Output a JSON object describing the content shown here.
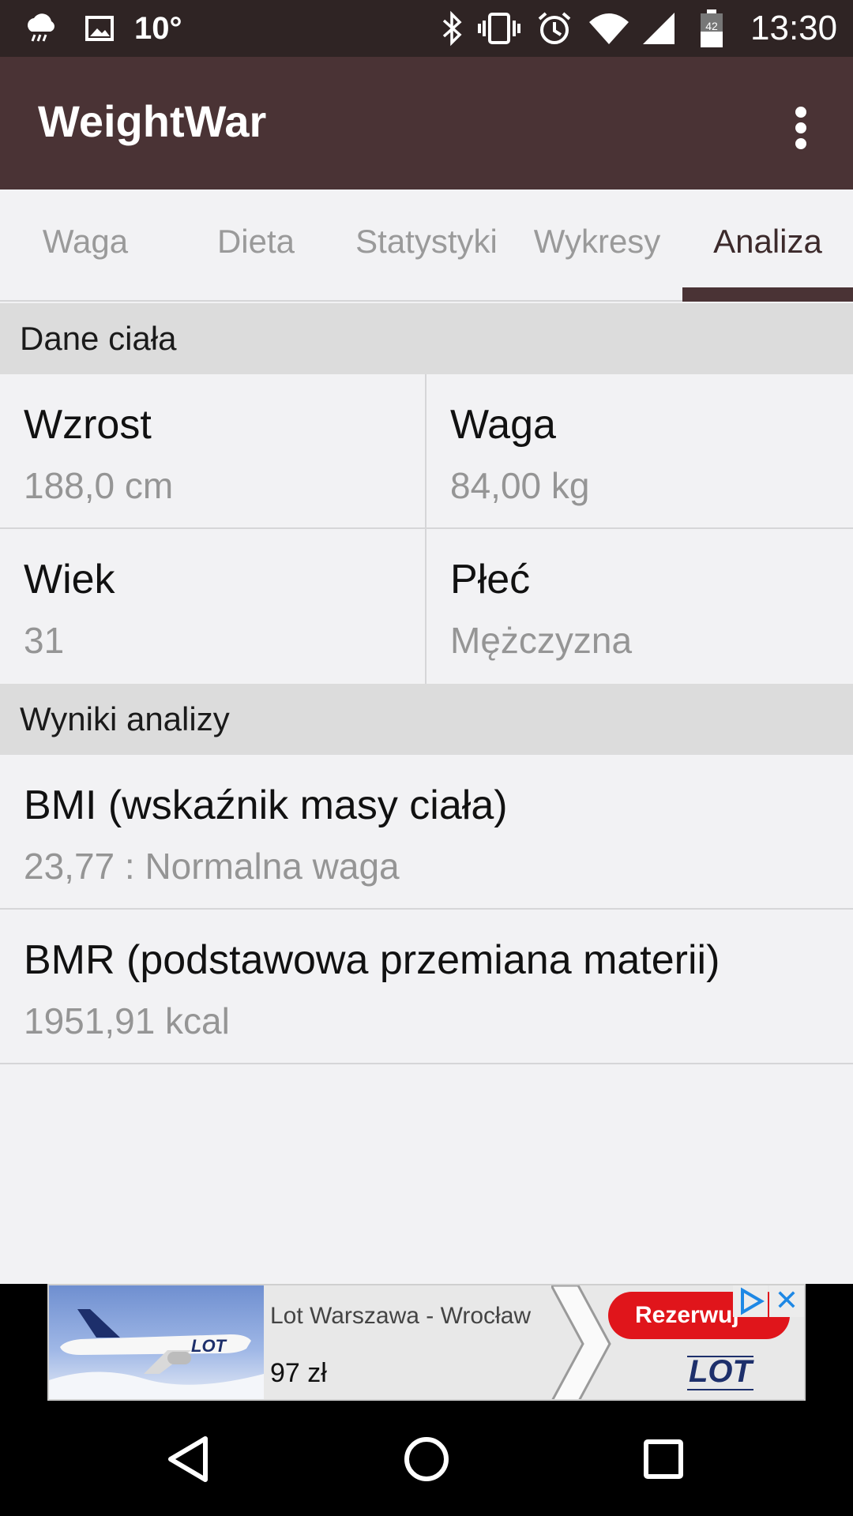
{
  "status_bar": {
    "temperature": "10°",
    "battery_level": "42",
    "time": "13:30",
    "icons": [
      "weather-rain-icon",
      "image-icon",
      "bluetooth-icon",
      "vibrate-icon",
      "alarm-icon",
      "wifi-icon",
      "signal-icon",
      "battery-icon"
    ]
  },
  "app_bar": {
    "title": "WeightWar",
    "menu_icon": "overflow-menu-icon"
  },
  "tabs": [
    {
      "label": "Waga",
      "active": false
    },
    {
      "label": "Dieta",
      "active": false
    },
    {
      "label": "Statystyki",
      "active": false
    },
    {
      "label": "Wykresy",
      "active": false
    },
    {
      "label": "Analiza",
      "active": true
    }
  ],
  "body_data": {
    "header": "Dane ciała",
    "items": [
      {
        "label": "Wzrost",
        "value": "188,0 cm"
      },
      {
        "label": "Waga",
        "value": "84,00 kg"
      },
      {
        "label": "Wiek",
        "value": "31"
      },
      {
        "label": "Płeć",
        "value": "Mężczyzna"
      }
    ]
  },
  "analysis": {
    "header": "Wyniki analizy",
    "items": [
      {
        "label": "BMI (wskaźnik masy ciała)",
        "value": "23,77 : Normalna waga"
      },
      {
        "label": "BMR (podstawowa przemiana materii)",
        "value": "1951,91 kcal"
      }
    ]
  },
  "ad": {
    "title": "Lot Warszawa - Wrocław",
    "price": "97 zł",
    "cta": "Rezerwuj",
    "logo_text": "LOT",
    "close_symbol": "✕"
  },
  "colors": {
    "app_bar": "#4a3335",
    "status_bar": "#2f2424",
    "accent": "#4a3335",
    "background": "#f2f2f4",
    "section_header": "#dcdcdc",
    "ad_cta": "#e0151b"
  }
}
